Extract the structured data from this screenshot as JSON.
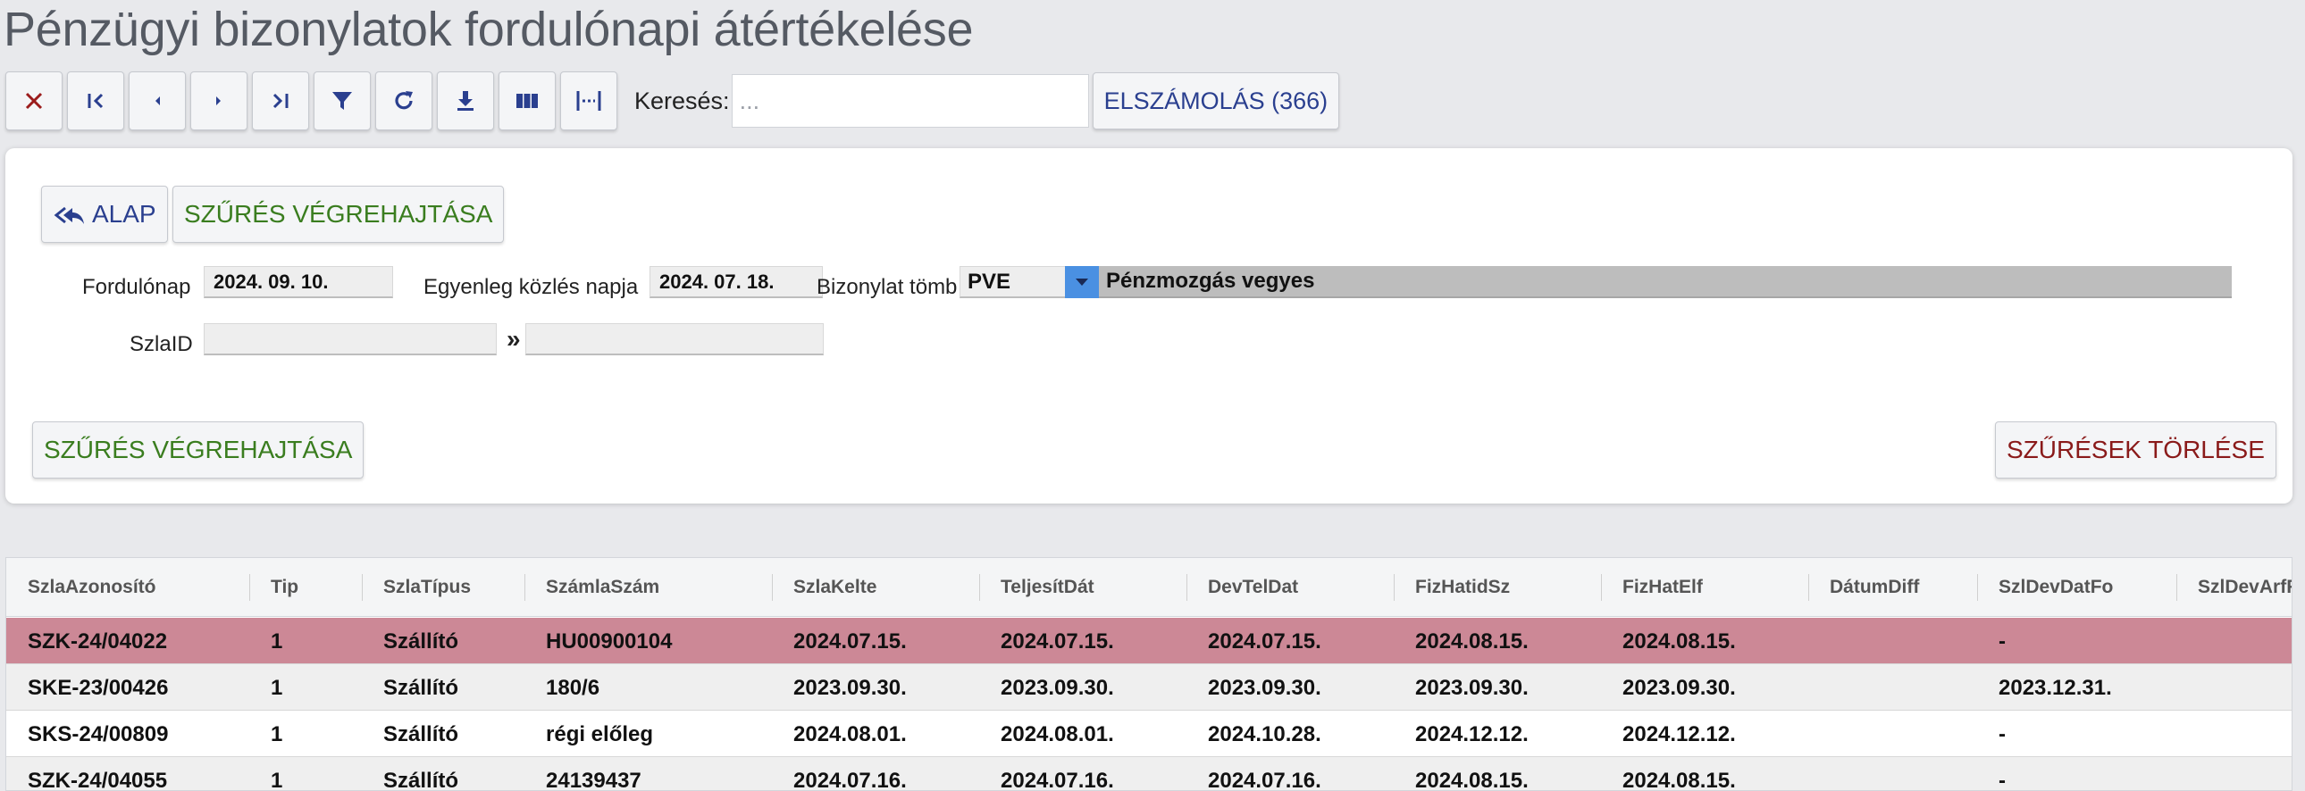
{
  "page": {
    "title": "Pénzügyi bizonylatok fordulónapi átértékelése"
  },
  "toolbar": {
    "buttons": [
      {
        "id": "close",
        "icon": "close-icon"
      },
      {
        "id": "first",
        "icon": "first-page-icon"
      },
      {
        "id": "prev",
        "icon": "prev-icon"
      },
      {
        "id": "next",
        "icon": "next-icon"
      },
      {
        "id": "last",
        "icon": "last-page-icon"
      },
      {
        "id": "filter",
        "icon": "filter-icon"
      },
      {
        "id": "refresh",
        "icon": "refresh-icon"
      },
      {
        "id": "download",
        "icon": "download-icon"
      },
      {
        "id": "columns",
        "icon": "columns-icon"
      },
      {
        "id": "fit",
        "icon": "fit-width-icon"
      }
    ],
    "search_label": "Keresés:",
    "search_placeholder": "...",
    "search_value": "",
    "elszamolas_label": "ELSZÁMOLÁS (366)"
  },
  "filter": {
    "alap_label": "ALAP",
    "execute_top_label": "SZŰRÉS VÉGREHAJTÁSA",
    "fordulonap_label": "Fordulónap",
    "fordulonap_value": "2024. 09. 10.",
    "egyenleg_label": "Egyenleg közlés napja",
    "egyenleg_value": "2024. 07. 18.",
    "bizonylat_label": "Bizonylat tömb",
    "bizonylat_code": "PVE",
    "bizonylat_desc": "Pénzmozgás vegyes",
    "szlaid_label": "SzlaID",
    "szlaid_from": "",
    "range_sep": "»",
    "szlaid_to": "",
    "execute_bottom_label": "SZŰRÉS VÉGREHAJTÁSA",
    "clear_label": "SZŰRÉSEK TÖRLÉSE"
  },
  "colors": {
    "selected_row": "#cc8896",
    "accent_blue": "#2a3f8f",
    "green": "#3a7d1f",
    "red": "#8a1a1a"
  },
  "grid": {
    "columns": [
      "SzlaAzonosító",
      "Tip",
      "SzlaTípus",
      "SzámlaSzám",
      "SzlaKelte",
      "TeljesítDát",
      "DevTelDat",
      "FizHatidSz",
      "FizHatElf",
      "DátumDiff",
      "SzlDevDatFo",
      "SzlDevArfFo"
    ],
    "rows": [
      [
        "SZK-24/04022",
        "1",
        "Szállító",
        "HU00900104",
        "2024.07.15.",
        "2024.07.15.",
        "2024.07.15.",
        "2024.08.15.",
        "2024.08.15.",
        "",
        "-",
        ""
      ],
      [
        "SKE-23/00426",
        "1",
        "Szállító",
        "180/6",
        "2023.09.30.",
        "2023.09.30.",
        "2023.09.30.",
        "2023.09.30.",
        "2023.09.30.",
        "",
        "2023.12.31.",
        ""
      ],
      [
        "SKS-24/00809",
        "1",
        "Szállító",
        "régi előleg",
        "2024.08.01.",
        "2024.08.01.",
        "2024.10.28.",
        "2024.12.12.",
        "2024.12.12.",
        "",
        "-",
        ""
      ],
      [
        "SZK-24/04055",
        "1",
        "Szállító",
        "24139437",
        "2024.07.16.",
        "2024.07.16.",
        "2024.07.16.",
        "2024.08.15.",
        "2024.08.15.",
        "",
        "-",
        ""
      ]
    ]
  }
}
